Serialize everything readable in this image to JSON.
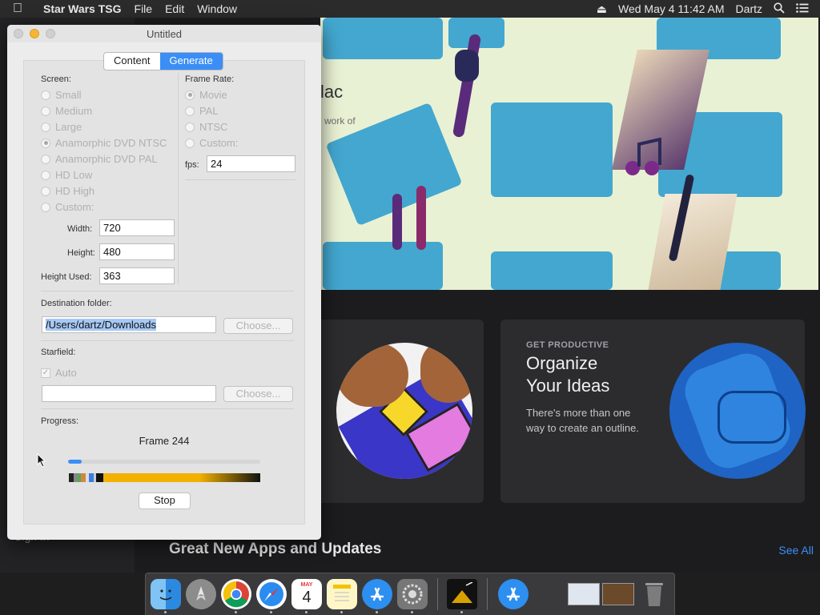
{
  "menubar": {
    "apple_icon": "apple-icon",
    "app_name": "Star Wars TSG",
    "menus": [
      "File",
      "Edit",
      "Window"
    ],
    "datetime": "Wed May 4  11:42 AM",
    "user": "Dartz"
  },
  "appstore": {
    "banner_heading": "lac",
    "banner_sub": "work of",
    "card": {
      "kicker": "GET PRODUCTIVE",
      "title_line1": "Organize",
      "title_line2": "Your Ideas",
      "desc_line1": "There's more than one",
      "desc_line2": "way to create an outline."
    },
    "section_title": "Great New Apps and Updates",
    "see_all": "See All",
    "sign_in": "Sign In"
  },
  "window": {
    "title": "Untitled",
    "tabs": [
      "Content",
      "Generate"
    ],
    "active_tab": "Generate",
    "screen": {
      "label": "Screen:",
      "options": [
        "Small",
        "Medium",
        "Large",
        "Anamorphic DVD NTSC",
        "Anamorphic DVD PAL",
        "HD Low",
        "HD High",
        "Custom:"
      ],
      "selected": "Anamorphic DVD NTSC",
      "width_label": "Width:",
      "width_value": "720",
      "height_label": "Height:",
      "height_value": "480",
      "height_used_label": "Height Used:",
      "height_used_value": "363"
    },
    "frame_rate": {
      "label": "Frame Rate:",
      "options": [
        "Movie",
        "PAL",
        "NTSC",
        "Custom:"
      ],
      "selected": "Movie",
      "fps_label": "fps:",
      "fps_value": "24"
    },
    "destination": {
      "label": "Destination folder:",
      "path": "/Users/dartz/Downloads",
      "choose_label": "Choose..."
    },
    "starfield": {
      "label": "Starfield:",
      "auto_label": "Auto",
      "auto_checked": true,
      "path": "",
      "choose_label": "Choose..."
    },
    "progress": {
      "label": "Progress:",
      "frame_text": "Frame 244",
      "fraction": 0.07,
      "stop_label": "Stop"
    }
  },
  "dock": {
    "apps": [
      "finder-icon",
      "launchpad-icon",
      "chrome-icon",
      "safari-icon",
      "calendar-icon",
      "notes-icon",
      "app-store-icon",
      "system-preferences-icon",
      "star-wars-tsg-icon",
      "app-store-downloads-icon",
      "screenshots-stack-icon",
      "trash-icon"
    ],
    "calendar_month": "MAY",
    "calendar_day": "4"
  }
}
